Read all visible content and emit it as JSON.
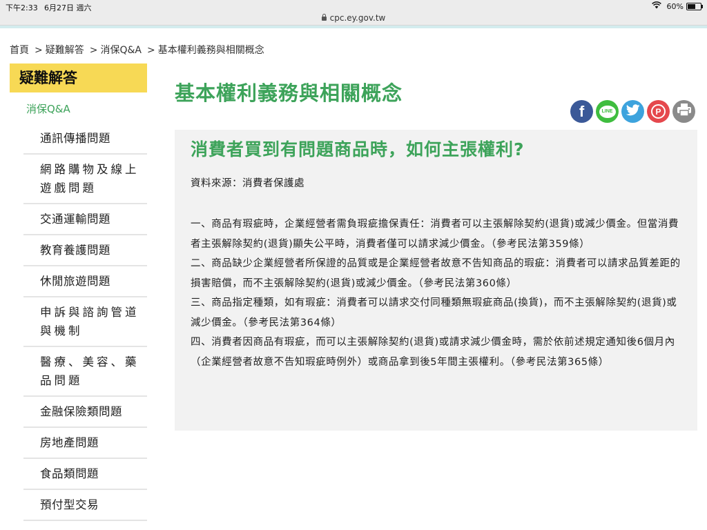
{
  "status_bar": {
    "time": "下午2:33",
    "date": "6月27日 週六",
    "battery": "60%",
    "battery_level": 0.6,
    "url": "cpc.ey.gov.tw"
  },
  "breadcrumb": [
    "首頁",
    "疑難解答",
    "消保Q&A",
    "基本權利義務與相關概念"
  ],
  "sidebar": {
    "heading": "疑難解答",
    "subheading": "消保Q&A",
    "items": [
      "通訊傳播問題",
      "網路購物及線上遊戲問題",
      "交通運輸問題",
      "教育養護問題",
      "休閒旅遊問題",
      "申訴與諮詢管道與機制",
      "醫療、美容、藥品問題",
      "金融保險類問題",
      "房地產問題",
      "食品類問題",
      "預付型交易"
    ]
  },
  "main": {
    "page_title": "基本權利義務與相關概念",
    "share": {
      "facebook": "f",
      "line": "LINE",
      "twitter": "twitter-icon",
      "plurk": "P",
      "print": "print-icon"
    },
    "article": {
      "title": "消費者買到有問題商品時，如何主張權利?",
      "source": "資料來源：消費者保護處",
      "paragraphs": [
        "一、商品有瑕疵時，企業經營者需負瑕疵擔保責任：消費者可以主張解除契約(退貨)或減少價金。但當消費者主張解除契約(退貨)顯失公平時，消費者僅可以請求減少價金。（參考民法第359條）",
        "二、商品缺少企業經營者所保證的品質或是企業經營者故意不告知商品的瑕疵：消費者可以請求品質差距的損害賠償，而不主張解除契約(退貨)或減少價金。（參考民法第360條）",
        "三、商品指定種類，如有瑕疵：消費者可以請求交付同種類無瑕疵商品(換貨)，而不主張解除契約(退貨)或減少價金。（參考民法第364條）",
        "四、消費者因商品有瑕疵，而可以主張解除契約(退貨)或請求減少價金時，需於依前述規定通知後6個月內（企業經營者故意不告知瑕疵時例外）或商品拿到後5年間主張權利。（參考民法第365條）"
      ]
    }
  },
  "colors": {
    "accent_green": "#3da35a",
    "sidebar_yellow": "#f7d955",
    "article_bg": "#f2f2f2"
  }
}
